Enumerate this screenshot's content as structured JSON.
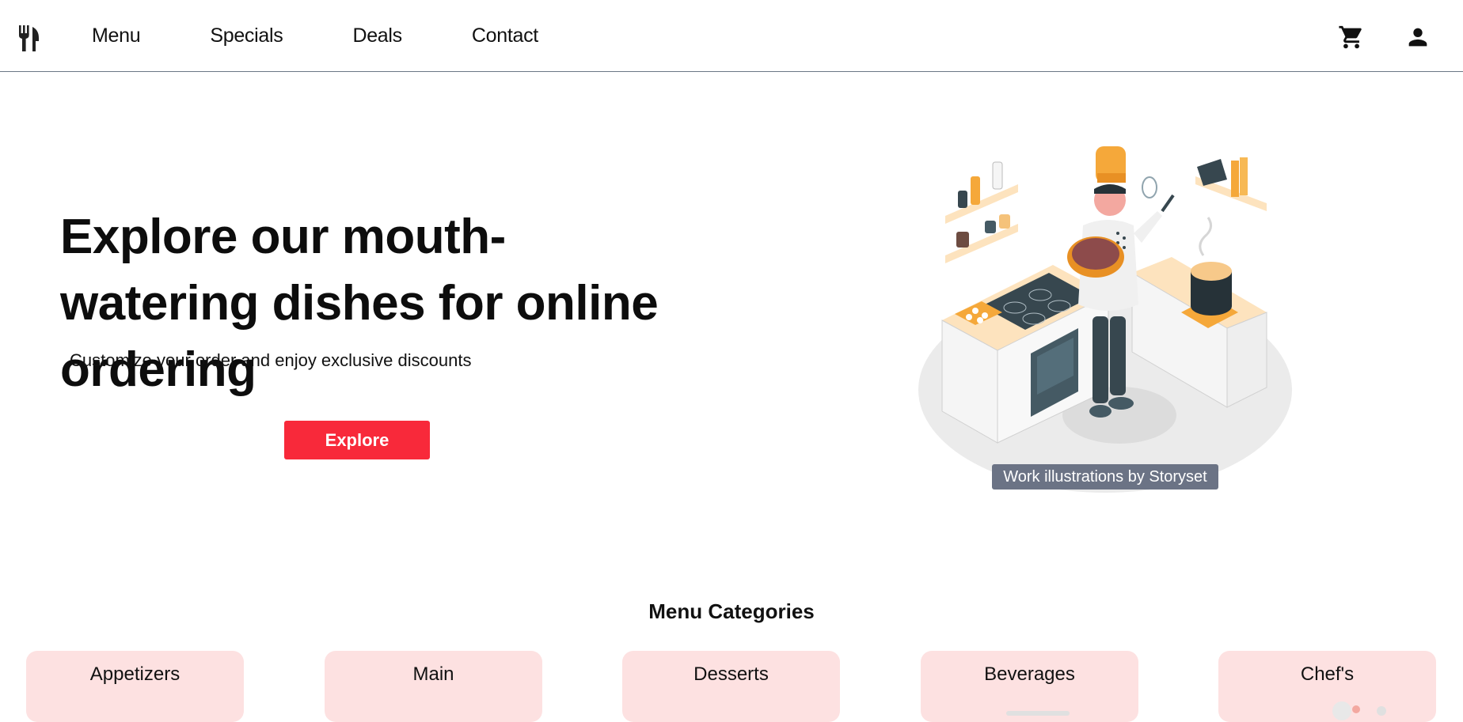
{
  "nav": {
    "logo_icon": "fork-knife-icon",
    "links": [
      {
        "label": "Menu"
      },
      {
        "label": "Specials"
      },
      {
        "label": "Deals"
      },
      {
        "label": "Contact"
      }
    ],
    "cart_icon": "cart-icon",
    "account_icon": "user-icon"
  },
  "hero": {
    "title": "Explore our mouth-watering dishes for online ordering",
    "subtitle": "Customize your order and enjoy exclusive discounts",
    "cta_label": "Explore",
    "cta_color": "#f8293a",
    "image_credit": "Work illustrations by Storyset"
  },
  "categories": {
    "title": "Menu Categories",
    "card_color": "#fde1e1",
    "items": [
      {
        "label": "Appetizers"
      },
      {
        "label": "Main"
      },
      {
        "label": "Desserts"
      },
      {
        "label": "Beverages"
      },
      {
        "label": "Chef's"
      }
    ]
  }
}
